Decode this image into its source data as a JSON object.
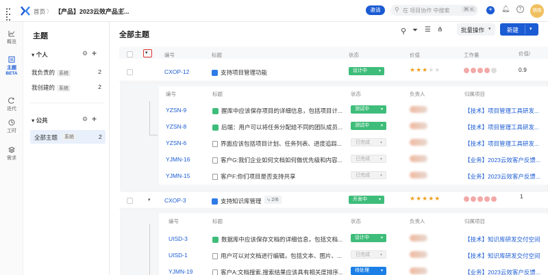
{
  "topbar": {
    "breadcrumb_home": "首页",
    "breadcrumb_sep": "〉",
    "breadcrumb_current": "【产品】2023云效产品主...",
    "invite": "邀请",
    "search_placeholder": "在 项目协作 中搜索",
    "shortcut": "⌘ K",
    "user_name": "晓晓"
  },
  "leftnav": [
    {
      "label": "概览",
      "icon": "chart-icon"
    },
    {
      "label": "主题",
      "sub": "BETA",
      "icon": "topic-icon",
      "active": true
    },
    {
      "label": "迭代",
      "icon": "iteration-icon"
    },
    {
      "label": "工时",
      "icon": "clock-icon"
    },
    {
      "label": "需求",
      "icon": "layers-icon"
    }
  ],
  "sidebar": {
    "title": "主题",
    "personal": "个人",
    "personal_items": [
      {
        "label": "我负责的",
        "badge": "系统",
        "count": "2"
      },
      {
        "label": "我创建的",
        "badge": "系统",
        "count": "2"
      }
    ],
    "public": "公共",
    "public_items": [
      {
        "label": "全部主题",
        "badge": "系统",
        "count": "2"
      }
    ]
  },
  "main": {
    "title": "全部主题",
    "batch": "批量操作",
    "new_btn": "新建",
    "headers": {
      "id": "编号",
      "title": "标题",
      "status": "状态",
      "value": "价值",
      "workload": "工作量",
      "value2": "价值/"
    },
    "rows": [
      {
        "id": "CXOP-12",
        "title": "支持项目管理功能",
        "status": "设计中",
        "stars": 3,
        "value2": "0.9",
        "sub_headers": {
          "id": "编号",
          "title": "标题",
          "status": "状态",
          "owner": "负责人",
          "project": "归属项目"
        },
        "children": [
          {
            "id": "YZSN-9",
            "title": "握库中应该保存项目的详细信息，包括项目计...",
            "status": "测试中",
            "status_kind": "green",
            "icon": "green",
            "project": "【技术】项目管理工具研发..."
          },
          {
            "id": "YZSN-8",
            "title": "后端：用户可以将任务分配给不同的团队成员...",
            "status": "测试中",
            "status_kind": "green",
            "icon": "green",
            "project": "【技术】项目管理工具研发..."
          },
          {
            "id": "YZSN-6",
            "title": "界面应该包括项目计划、任务列表、进度追踪...",
            "status": "已完成",
            "status_kind": "gray",
            "icon": "doc",
            "project": "【技术】项目管理工具研发..."
          },
          {
            "id": "YJMN-16",
            "title": "客户G:我们企业如何文档如何做优先级和内容...",
            "status": "已完成",
            "status_kind": "gray",
            "icon": "doc",
            "project": "【业务】2023云效客户反馈..."
          },
          {
            "id": "YJMN-15",
            "title": "客户F:你们项目是否支持共享",
            "status": "已完成",
            "status_kind": "gray",
            "icon": "doc",
            "project": "【业务】2023云效客户反馈..."
          }
        ]
      },
      {
        "id": "CXOP-3",
        "title": "支持知识库管理",
        "progress": "2/6",
        "status": "开发中",
        "stars": 5,
        "value2": "1",
        "sub_headers": {
          "id": "编号",
          "title": "标题",
          "status": "状态",
          "owner": "负责人",
          "project": "归属项目"
        },
        "children": [
          {
            "id": "UISD-3",
            "title": "数据库中应该保存文档的详细信息，包括文档...",
            "status": "设计中",
            "status_kind": "green",
            "icon": "green",
            "project": "【技术】知识库研发交付空间"
          },
          {
            "id": "UISD-1",
            "title": "用户可以对文档进行编辑，包括文本、图片、...",
            "status": "已完成",
            "status_kind": "gray",
            "icon": "doc",
            "project": "【技术】知识库研发交付空间"
          },
          {
            "id": "YJMN-19",
            "title": "客户A:文档搜索,搜索结果应该具有相关度排序...",
            "status": "待处理",
            "status_kind": "blue",
            "icon": "doc",
            "project": "【业务】2023云效客户反馈..."
          }
        ]
      }
    ]
  },
  "colors": {
    "accent": "#1b5bd3",
    "green": "#3ebd7a",
    "orange": "#f0a020",
    "pink": "#f3a8a8"
  }
}
